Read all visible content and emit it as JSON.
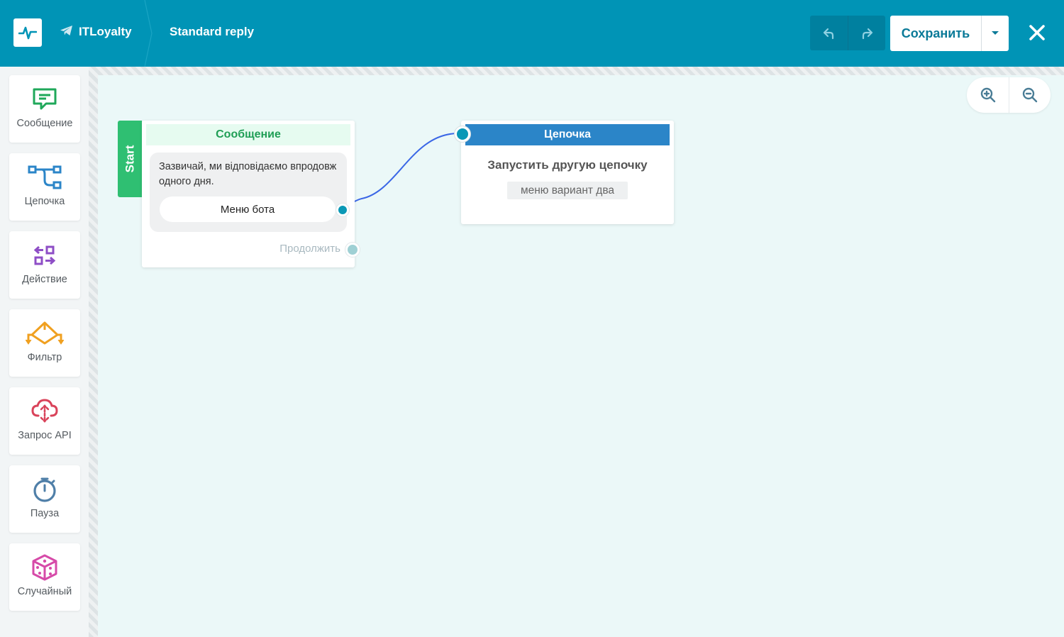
{
  "header": {
    "project_name": "ITLoyalty",
    "page_title": "Standard reply",
    "save_label": "Сохранить",
    "logo_icon": "pulse-icon",
    "project_icon": "telegram-icon",
    "background_color": "#0094b6"
  },
  "sidebar": {
    "items": [
      {
        "label": "Сообщение",
        "icon": "message-icon",
        "color": "#1fa85a"
      },
      {
        "label": "Цепочка",
        "icon": "chain-icon",
        "color": "#2b85c8"
      },
      {
        "label": "Действие",
        "icon": "action-icon",
        "color": "#8e4ec6"
      },
      {
        "label": "Фильтр",
        "icon": "filter-icon",
        "color": "#f0a020"
      },
      {
        "label": "Запрос API",
        "icon": "api-icon",
        "color": "#d9435a"
      },
      {
        "label": "Пауза",
        "icon": "timer-icon",
        "color": "#4f7fa8"
      },
      {
        "label": "Случайный",
        "icon": "dice-icon",
        "color": "#d64aa8"
      }
    ]
  },
  "canvas": {
    "message_node": {
      "start_label": "Start",
      "title": "Сообщение",
      "text": "Зазвичай, ми відповідаємо впродовж одного дня.",
      "button_label": "Меню бота",
      "continue_label": "Продолжить"
    },
    "chain_node": {
      "title": "Цепочка",
      "action": "Запустить другую цепочку",
      "target": "меню вариант два"
    }
  }
}
